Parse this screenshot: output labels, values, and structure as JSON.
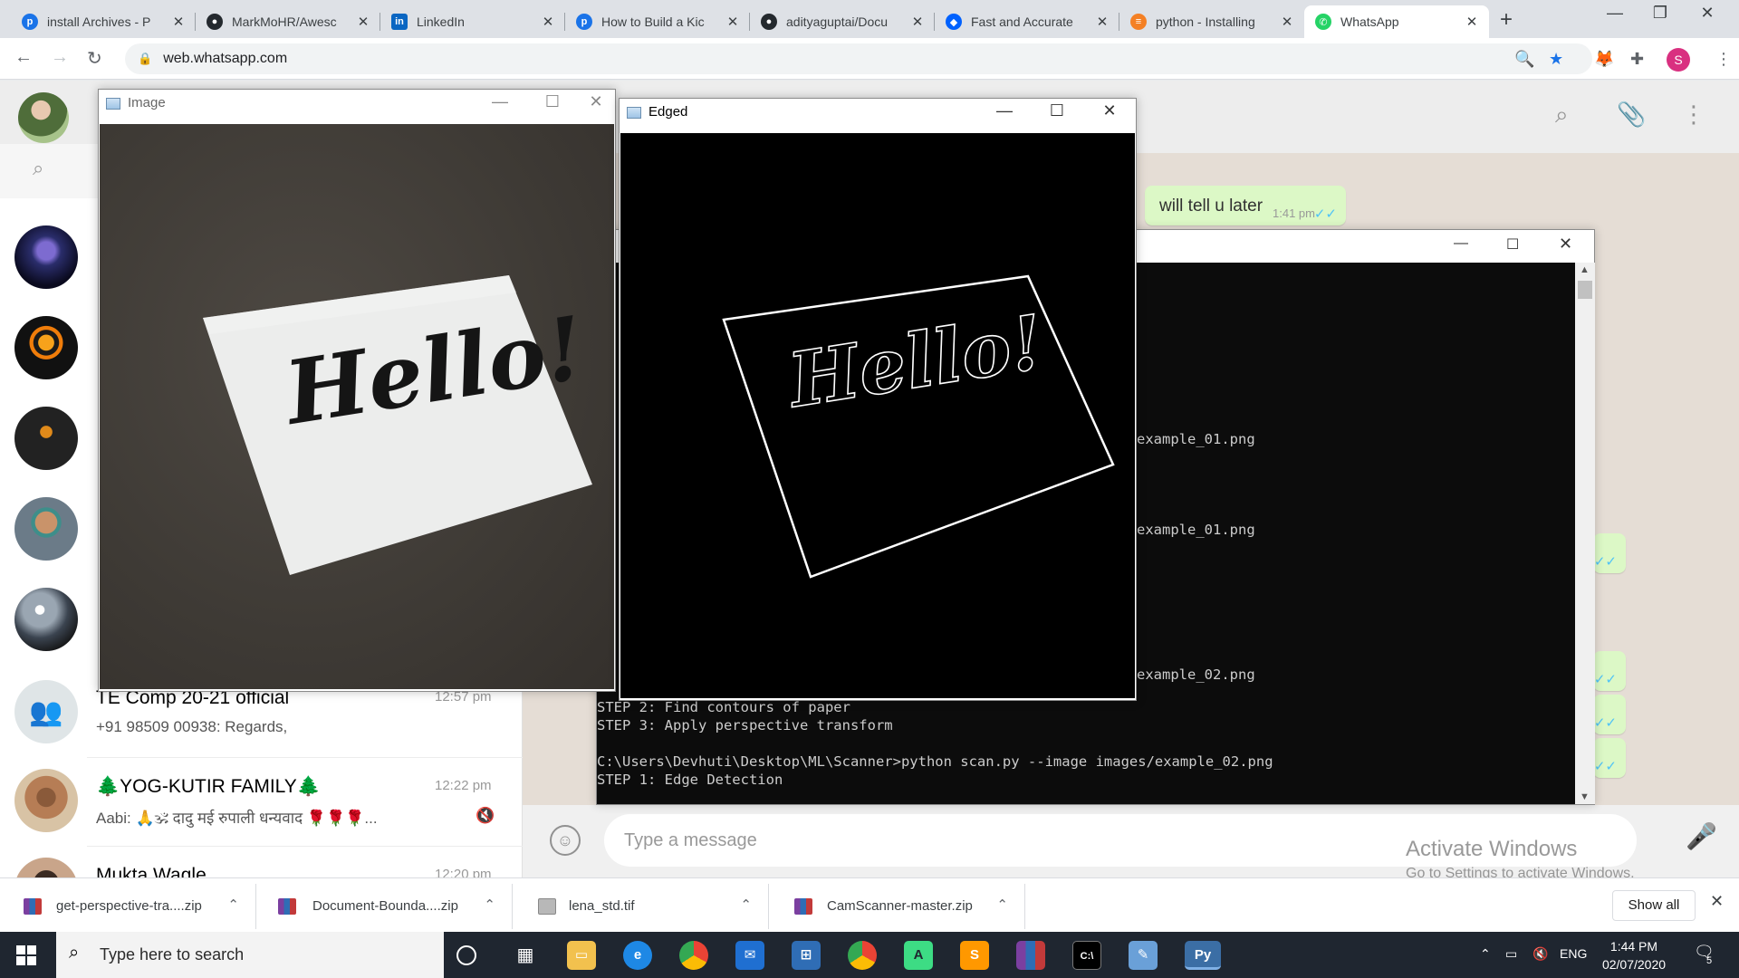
{
  "browser": {
    "tabs": [
      {
        "title": "install Archives - P",
        "favicon": "p-icon",
        "color": "#1a73e8",
        "glyph": "p"
      },
      {
        "title": "MarkMoHR/Awesc",
        "favicon": "github-icon",
        "color": "#24292e",
        "glyph": "●"
      },
      {
        "title": "LinkedIn",
        "favicon": "linkedin-icon",
        "color": "#0a66c2",
        "glyph": "in"
      },
      {
        "title": "How to Build a Kic",
        "favicon": "p-icon",
        "color": "#1a73e8",
        "glyph": "p"
      },
      {
        "title": "adityaguptai/Docu",
        "favicon": "github-icon",
        "color": "#24292e",
        "glyph": "●"
      },
      {
        "title": "Fast and Accurate",
        "favicon": "dropbox-icon",
        "color": "#0061fe",
        "glyph": "◆"
      },
      {
        "title": "python - Installing",
        "favicon": "stackoverflow-icon",
        "color": "#f48024",
        "glyph": "≡"
      },
      {
        "title": "WhatsApp",
        "favicon": "whatsapp-icon",
        "color": "#25d366",
        "glyph": "✆"
      }
    ],
    "url": "web.whatsapp.com"
  },
  "whatsapp": {
    "chats": [
      {
        "name": "TE Comp 20-21 official",
        "preview": "+91 98509 00938: Regards,",
        "time": "12:57 pm"
      },
      {
        "name": "🌲YOG-KUTIR FAMILY🌲",
        "preview": "Aabi: 🙏🕉 दादु मई रुपाली धन्यवाद 🌹🌹🌹...",
        "time": "12:22 pm",
        "muted": true
      },
      {
        "name": "Mukta Wagle",
        "preview": "",
        "time": "12:20 pm"
      }
    ],
    "last_message": {
      "text": "will tell u later",
      "time": "1:41 pm"
    },
    "composer_placeholder": "Type a message"
  },
  "windows": {
    "image_title": "Image",
    "edged_title": "Edged",
    "hello_text": "Hello!"
  },
  "console": {
    "lines": [
      {
        "text": "example_01.png",
        "partial": true
      },
      {
        "text": "example_01.png",
        "partial": true
      },
      {
        "text": "example_02.png",
        "partial": true
      },
      {
        "text": "STEP 2: Find contours of paper"
      },
      {
        "text": "STEP 3: Apply perspective transform"
      },
      {
        "text": ""
      },
      {
        "text": "C:\\Users\\Devhuti\\Desktop\\ML\\Scanner>python scan.py --image images/example_02.png"
      },
      {
        "text": "STEP 1: Edge Detection"
      }
    ]
  },
  "watermark": {
    "line1": "Activate Windows",
    "line2": "Go to Settings to activate Windows."
  },
  "downloads": {
    "items": [
      {
        "name": "get-perspective-tra....zip",
        "icon": "winrar-icon",
        "color": "#7b3fa0"
      },
      {
        "name": "Document-Bounda....zip",
        "icon": "winrar-icon",
        "color": "#7b3fa0"
      },
      {
        "name": "lena_std.tif",
        "icon": "image-file-icon",
        "color": "#8a8a8a"
      },
      {
        "name": "CamScanner-master.zip",
        "icon": "winrar-icon",
        "color": "#7b3fa0"
      }
    ],
    "show_all": "Show all"
  },
  "taskbar": {
    "search_placeholder": "Type here to search",
    "language": "ENG",
    "time": "1:44 PM",
    "date": "02/07/2020",
    "notification_count": "5"
  }
}
